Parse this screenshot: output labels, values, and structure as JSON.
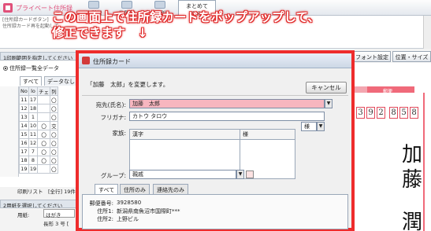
{
  "app": {
    "title": "プライベート住所録",
    "ribbon": [
      {
        "label": "住所録"
      },
      {
        "label": "住所録"
      },
      {
        "label": "個別"
      }
    ],
    "ribbon_active": {
      "label": "まとめて",
      "sub": "印刷"
    },
    "notes_text": "[住所録カードボタン]\n住所録カード再を起動して"
  },
  "left": {
    "section1": "1印刷範囲を指定してください",
    "radio_label": "住所録一覧全データ",
    "tabs": [
      "すべて",
      "データなし"
    ],
    "table_headers": [
      "No",
      "lo",
      "チェ",
      "列"
    ],
    "rows": [
      {
        "no": "11",
        "lo": "17",
        "chk": "",
        "col": "〇"
      },
      {
        "no": "12",
        "lo": "18",
        "chk": "",
        "col": "〇"
      },
      {
        "no": "13",
        "lo": "1",
        "chk": "",
        "col": "〇"
      },
      {
        "no": "14",
        "lo": "10",
        "chk": "〇",
        "col": "交"
      },
      {
        "no": "15",
        "lo": "11",
        "chk": "〇",
        "col": "〇"
      },
      {
        "no": "16",
        "lo": "12",
        "chk": "〇",
        "col": "〇"
      },
      {
        "no": "17",
        "lo": "7",
        "chk": "〇",
        "col": "〇"
      },
      {
        "no": "18",
        "lo": "8",
        "chk": "〇",
        "col": "〇"
      },
      {
        "no": "19",
        "lo": "19",
        "chk": "",
        "col": "〇"
      }
    ],
    "print_list": "印刷リスト　[全行]  19件",
    "section2": "2用紙を選択してください",
    "paper_label": "用紙:",
    "paper_value": "はがき",
    "paper_value2": "長形 3 号 [",
    "rownum_label": "印"
  },
  "right": {
    "toolbar": [
      "フォント設定",
      "位置・サイズ"
    ],
    "postcard_label": "郵便",
    "zip_digits": [
      "3",
      "9",
      "2",
      "8",
      "5",
      "8"
    ],
    "name_chars": [
      "加",
      "藤",
      "潤"
    ]
  },
  "dialog": {
    "title": "住所録カード",
    "message": "「加藤　太郎」を変更します。",
    "cancel_label": "キャンセル",
    "fields": {
      "name_label": "宛先(氏名):",
      "name_value": "加藤　太郎",
      "furigana_label": "フリガナ:",
      "furigana_value": "カトウ タロウ",
      "family_label": "家族:",
      "group_label": "グループ:",
      "group_value": "親戚"
    },
    "family_table": {
      "headers": [
        "漢字",
        "様"
      ],
      "suffix_select": "様"
    },
    "tabs": [
      "すべて",
      "住所のみ",
      "連絡先のみ"
    ],
    "address": [
      {
        "label": "郵便番号:",
        "value": "3928580"
      },
      {
        "label": "住所1:",
        "value": "新潟県南魚沼市国際町***"
      },
      {
        "label": "住所2:",
        "value": "上野ビル"
      }
    ]
  },
  "annotation": {
    "line1": "この画面上で住所録カードをポップアップして、",
    "line2": "修正できます　↓"
  },
  "colors": {
    "highlight": "#ee2c2c",
    "pink_field": "#f7b6bf",
    "postcard_red": "#f06a7a"
  }
}
